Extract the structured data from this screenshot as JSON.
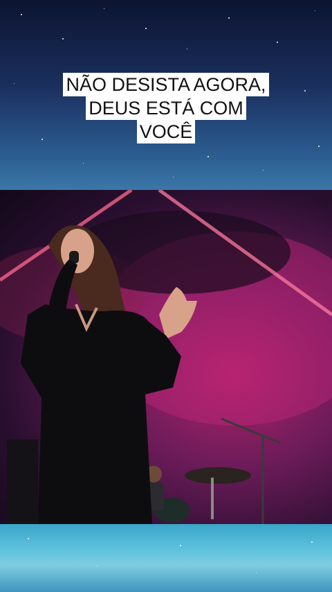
{
  "caption": {
    "line1": "NÃO DESISTA AGORA,",
    "line2": "DEUS ESTÁ COM",
    "line3": "VOCÊ"
  },
  "photo": {
    "subject": "singer-performing",
    "colors": {
      "stage_magenta": "#b0226a",
      "stage_dark": "#12081a",
      "dress": "#0d0d10"
    }
  },
  "background": {
    "top_colors": [
      "#0c1430",
      "#3b77a8"
    ],
    "bottom_colors": [
      "#3aa6c9",
      "#7fcde0"
    ]
  }
}
